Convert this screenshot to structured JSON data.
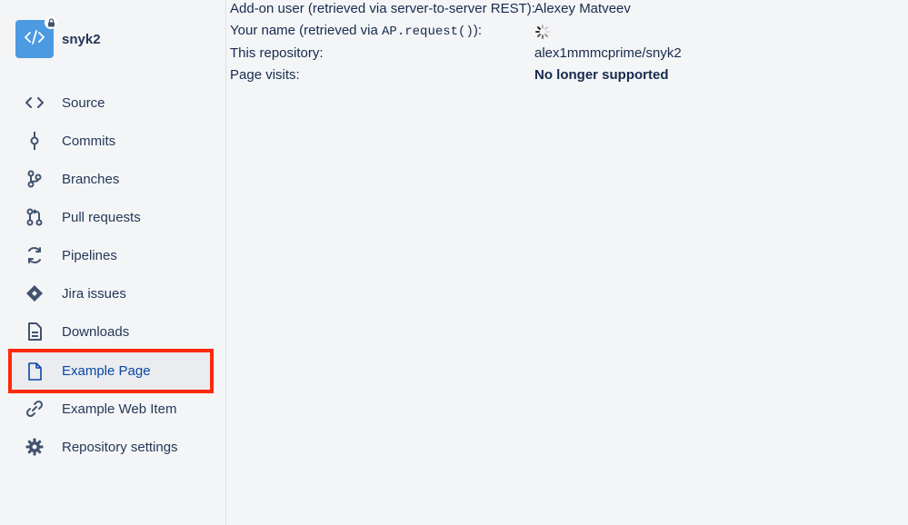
{
  "repo": {
    "name": "snyk2",
    "avatar_icon": "code-icon",
    "badge_icon": "lock-icon"
  },
  "sidebar": {
    "items": [
      {
        "label": "Source",
        "icon": "source-code-icon"
      },
      {
        "label": "Commits",
        "icon": "commit-icon"
      },
      {
        "label": "Branches",
        "icon": "branch-icon"
      },
      {
        "label": "Pull requests",
        "icon": "pull-request-icon"
      },
      {
        "label": "Pipelines",
        "icon": "pipelines-icon"
      },
      {
        "label": "Jira issues",
        "icon": "jira-icon"
      },
      {
        "label": "Downloads",
        "icon": "document-icon"
      },
      {
        "label": "Example Page",
        "icon": "page-icon",
        "selected": true
      },
      {
        "label": "Example Web Item",
        "icon": "link-icon"
      },
      {
        "label": "Repository settings",
        "icon": "gear-icon"
      }
    ]
  },
  "content": {
    "addon_user_label": "Add-on user (retrieved via server-to-server REST):",
    "addon_user_value": "Alexey Matveev",
    "your_name_label_prefix": "Your name (retrieved via ",
    "your_name_label_code": "AP.request()",
    "your_name_label_suffix": "):",
    "repository_label": "This repository:",
    "repository_value": "alex1mmmcprime/snyk2",
    "page_visits_label": "Page visits:",
    "page_visits_value": "No longer supported"
  },
  "colors": {
    "accent": "#0747a6",
    "highlight_border": "#ff2a0b",
    "avatar": "#4c9ae2"
  }
}
